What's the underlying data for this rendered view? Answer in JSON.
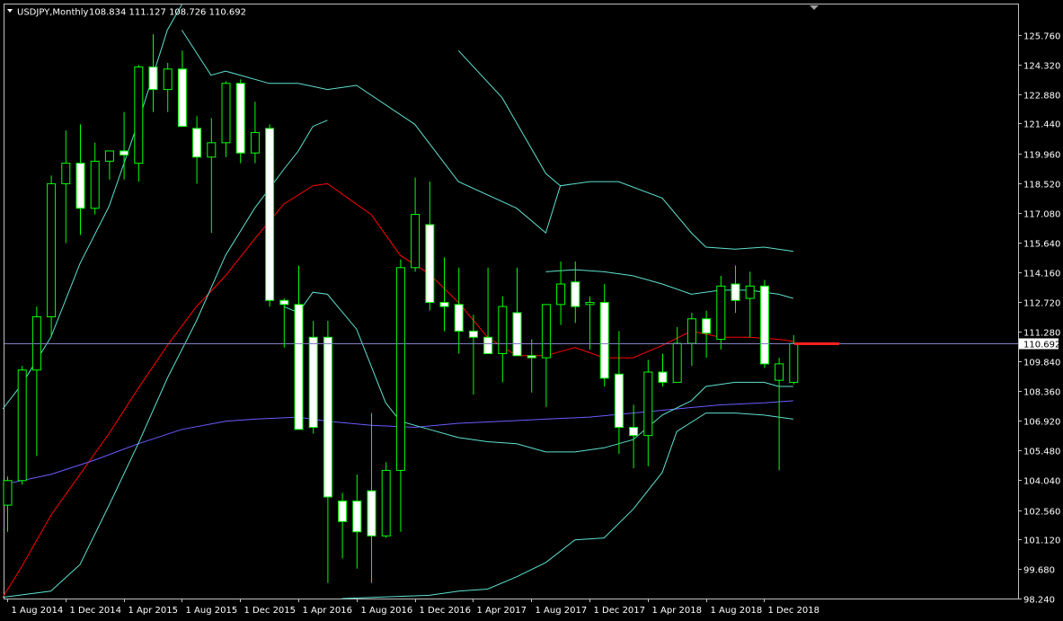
{
  "header": {
    "symbol_timeframe": "USDJPY,Monthly",
    "ohlc": "108.834 111.127 108.726 110.692"
  },
  "colors": {
    "background": "#000000",
    "frame": "#c0c0c0",
    "candle_up": "#000000",
    "candle_down": "#ffffff",
    "wick": "#00ff00",
    "ma_fast": "#ff0000",
    "ma_slow": "#6b5cff",
    "bands": "#5ee0d0",
    "price_line": "#8080c0",
    "price_marker": "#ff2020"
  },
  "chart_data": {
    "type": "candlestick",
    "y_ticks": [
      "125.760",
      "124.320",
      "122.880",
      "121.440",
      "119.960",
      "118.520",
      "117.080",
      "115.640",
      "114.160",
      "112.720",
      "111.280",
      "109.840",
      "108.360",
      "106.920",
      "105.480",
      "104.040",
      "102.560",
      "101.120",
      "99.680",
      "98.240"
    ],
    "x_ticks": [
      "1 Aug 2014",
      "1 Dec 2014",
      "1 Apr 2015",
      "1 Aug 2015",
      "1 Dec 2015",
      "1 Apr 2016",
      "1 Aug 2016",
      "1 Dec 2016",
      "1 Apr 2017",
      "1 Aug 2017",
      "1 Dec 2017",
      "1 Apr 2018",
      "1 Aug 2018",
      "1 Dec 2018"
    ],
    "ylim": [
      98.24,
      125.76
    ],
    "current_price": "110.692",
    "candles": [
      {
        "o": 102.8,
        "h": 104.2,
        "l": 101.5,
        "c": 104.0
      },
      {
        "o": 104.0,
        "h": 109.6,
        "l": 103.8,
        "c": 109.4
      },
      {
        "o": 109.4,
        "h": 112.5,
        "l": 105.2,
        "c": 112.0
      },
      {
        "o": 112.0,
        "h": 118.9,
        "l": 111.0,
        "c": 118.5
      },
      {
        "o": 118.5,
        "h": 121.1,
        "l": 115.6,
        "c": 119.5
      },
      {
        "o": 119.5,
        "h": 121.4,
        "l": 116.0,
        "c": 117.3
      },
      {
        "o": 117.3,
        "h": 120.5,
        "l": 117.0,
        "c": 119.6
      },
      {
        "o": 119.6,
        "h": 120.0,
        "l": 118.7,
        "c": 120.1
      },
      {
        "o": 120.1,
        "h": 122.0,
        "l": 118.7,
        "c": 119.9
      },
      {
        "o": 119.5,
        "h": 124.3,
        "l": 118.6,
        "c": 124.2
      },
      {
        "o": 124.2,
        "h": 125.8,
        "l": 122.0,
        "c": 123.1
      },
      {
        "o": 123.1,
        "h": 124.4,
        "l": 122.0,
        "c": 124.1
      },
      {
        "o": 124.1,
        "h": 125.0,
        "l": 121.5,
        "c": 121.3
      },
      {
        "o": 121.2,
        "h": 121.8,
        "l": 118.5,
        "c": 119.8
      },
      {
        "o": 119.8,
        "h": 121.7,
        "l": 116.1,
        "c": 120.5
      },
      {
        "o": 120.5,
        "h": 123.5,
        "l": 119.8,
        "c": 123.4
      },
      {
        "o": 123.4,
        "h": 123.6,
        "l": 119.5,
        "c": 120.0
      },
      {
        "o": 120.0,
        "h": 122.5,
        "l": 119.5,
        "c": 121.0
      },
      {
        "o": 121.2,
        "h": 121.4,
        "l": 112.5,
        "c": 112.8
      },
      {
        "o": 112.8,
        "h": 112.9,
        "l": 110.5,
        "c": 112.6
      },
      {
        "o": 112.6,
        "h": 114.5,
        "l": 110.8,
        "c": 106.5
      },
      {
        "o": 111.0,
        "h": 111.8,
        "l": 106.3,
        "c": 106.6
      },
      {
        "o": 111.0,
        "h": 111.8,
        "l": 99.0,
        "c": 103.2
      },
      {
        "o": 103.0,
        "h": 103.4,
        "l": 100.2,
        "c": 102.0
      },
      {
        "o": 103.0,
        "h": 104.3,
        "l": 99.7,
        "c": 101.5
      },
      {
        "o": 103.5,
        "h": 107.3,
        "l": 99.0,
        "c": 101.3
      },
      {
        "o": 101.3,
        "h": 104.9,
        "l": 101.2,
        "c": 104.5
      },
      {
        "o": 104.5,
        "h": 114.8,
        "l": 101.5,
        "c": 114.4
      },
      {
        "o": 114.4,
        "h": 118.8,
        "l": 114.2,
        "c": 117.0
      },
      {
        "o": 116.5,
        "h": 118.6,
        "l": 112.3,
        "c": 112.7
      },
      {
        "o": 112.7,
        "h": 114.9,
        "l": 111.3,
        "c": 112.5
      },
      {
        "o": 112.6,
        "h": 114.4,
        "l": 110.2,
        "c": 111.3
      },
      {
        "o": 111.3,
        "h": 112.1,
        "l": 108.2,
        "c": 111.0
      },
      {
        "o": 111.0,
        "h": 114.4,
        "l": 110.7,
        "c": 110.2
      },
      {
        "o": 110.2,
        "h": 113.0,
        "l": 108.8,
        "c": 112.5
      },
      {
        "o": 112.2,
        "h": 114.4,
        "l": 110.5,
        "c": 110.1
      },
      {
        "o": 110.1,
        "h": 110.9,
        "l": 108.3,
        "c": 110.0
      },
      {
        "o": 110.0,
        "h": 112.6,
        "l": 107.6,
        "c": 112.6
      },
      {
        "o": 112.6,
        "h": 114.7,
        "l": 111.6,
        "c": 113.6
      },
      {
        "o": 113.7,
        "h": 114.7,
        "l": 111.7,
        "c": 112.5
      },
      {
        "o": 112.6,
        "h": 113.0,
        "l": 110.4,
        "c": 112.7
      },
      {
        "o": 112.7,
        "h": 113.6,
        "l": 108.6,
        "c": 109.0
      },
      {
        "o": 109.2,
        "h": 111.3,
        "l": 105.3,
        "c": 106.6
      },
      {
        "o": 106.6,
        "h": 107.7,
        "l": 104.6,
        "c": 106.2
      },
      {
        "o": 106.2,
        "h": 109.9,
        "l": 104.7,
        "c": 109.3
      },
      {
        "o": 109.3,
        "h": 110.2,
        "l": 108.6,
        "c": 108.8
      },
      {
        "o": 108.8,
        "h": 111.5,
        "l": 108.8,
        "c": 110.7
      },
      {
        "o": 110.7,
        "h": 112.2,
        "l": 109.6,
        "c": 111.9
      },
      {
        "o": 111.9,
        "h": 112.3,
        "l": 110.0,
        "c": 111.2
      },
      {
        "o": 110.9,
        "h": 114.0,
        "l": 110.4,
        "c": 113.5
      },
      {
        "o": 113.6,
        "h": 114.5,
        "l": 112.2,
        "c": 112.8
      },
      {
        "o": 112.9,
        "h": 114.2,
        "l": 111.0,
        "c": 113.5
      },
      {
        "o": 113.5,
        "h": 113.8,
        "l": 109.5,
        "c": 109.7
      },
      {
        "o": 108.9,
        "h": 110.0,
        "l": 104.5,
        "c": 109.7
      },
      {
        "o": 108.8,
        "h": 111.1,
        "l": 108.7,
        "c": 110.7
      }
    ],
    "series": [
      {
        "points": [
          [
            -0.3,
            98.3
          ],
          [
            1,
            99.8
          ],
          [
            3,
            102.3
          ],
          [
            5,
            104.3
          ],
          [
            7,
            106.3
          ],
          [
            9,
            108.5
          ],
          [
            11,
            110.6
          ],
          [
            13,
            112.5
          ],
          [
            15,
            114.0
          ],
          [
            17,
            115.8
          ],
          [
            19,
            117.5
          ],
          [
            21,
            118.4
          ],
          [
            22,
            118.5
          ],
          [
            25,
            117.0
          ],
          [
            27,
            115.0
          ],
          [
            29,
            114.1
          ],
          [
            31,
            112.7
          ],
          [
            33,
            111.0
          ],
          [
            35,
            110.1
          ],
          [
            37,
            110.1
          ],
          [
            39,
            110.5
          ],
          [
            41,
            110.0
          ],
          [
            43,
            110.0
          ],
          [
            45,
            110.6
          ],
          [
            47,
            111.3
          ],
          [
            49,
            111.0
          ],
          [
            51,
            111.0
          ],
          [
            53,
            110.9
          ],
          [
            54,
            110.8
          ]
        ]
      },
      {
        "points": [
          [
            -0.3,
            103.8
          ],
          [
            3,
            104.3
          ],
          [
            6,
            105.0
          ],
          [
            9,
            105.8
          ],
          [
            12,
            106.5
          ],
          [
            15,
            106.9
          ],
          [
            17,
            107.0
          ],
          [
            20,
            107.1
          ],
          [
            22,
            106.9
          ],
          [
            25,
            106.7
          ],
          [
            28,
            106.6
          ],
          [
            31,
            106.8
          ],
          [
            34,
            106.9
          ],
          [
            37,
            107.0
          ],
          [
            40,
            107.1
          ],
          [
            43,
            107.3
          ],
          [
            46,
            107.5
          ],
          [
            49,
            107.7
          ],
          [
            52,
            107.8
          ],
          [
            54,
            107.9
          ]
        ]
      },
      {
        "points": [
          [
            -0.3,
            107.5
          ],
          [
            1,
            108.7
          ],
          [
            3,
            111.0
          ],
          [
            5,
            114.6
          ],
          [
            7,
            117.4
          ],
          [
            9,
            121.5
          ],
          [
            11,
            126.0
          ],
          [
            12,
            128.0
          ]
        ],
        "off_top": true
      },
      {
        "points": [
          [
            -0.3,
            98.3
          ],
          [
            3,
            98.6
          ],
          [
            5,
            99.9
          ],
          [
            7,
            102.8
          ],
          [
            9,
            105.8
          ],
          [
            11,
            109.0
          ],
          [
            13,
            111.8
          ],
          [
            15,
            115.0
          ],
          [
            17,
            117.3
          ],
          [
            19,
            119.2
          ],
          [
            20,
            120.1
          ],
          [
            21,
            121.3
          ],
          [
            22,
            121.6
          ]
        ]
      },
      {
        "points": [
          [
            19,
            112.5
          ],
          [
            20,
            112.2
          ],
          [
            21,
            113.2
          ],
          [
            22,
            113.1
          ],
          [
            24,
            111.4
          ],
          [
            26,
            107.8
          ],
          [
            27,
            106.9
          ],
          [
            29,
            106.5
          ],
          [
            31,
            106.1
          ],
          [
            33,
            105.9
          ],
          [
            35,
            105.8
          ],
          [
            37,
            105.4
          ],
          [
            39,
            105.4
          ],
          [
            41,
            105.6
          ],
          [
            43,
            106.0
          ],
          [
            45,
            107.2
          ],
          [
            47,
            107.9
          ],
          [
            48,
            108.6
          ],
          [
            50,
            108.8
          ],
          [
            52,
            108.8
          ],
          [
            53,
            108.6
          ],
          [
            54,
            108.6
          ]
        ]
      },
      {
        "points": [
          [
            23,
            98.2
          ],
          [
            29,
            98.4
          ],
          [
            31,
            98.6
          ],
          [
            33,
            98.7
          ],
          [
            35,
            99.3
          ],
          [
            37,
            100.0
          ],
          [
            39,
            101.1
          ],
          [
            41,
            101.2
          ],
          [
            43,
            102.6
          ],
          [
            45,
            104.4
          ],
          [
            46,
            106.4
          ],
          [
            48,
            107.3
          ],
          [
            50,
            107.3
          ],
          [
            52,
            107.2
          ],
          [
            54,
            107.0
          ]
        ]
      },
      {
        "points": [
          [
            12,
            126.0
          ],
          [
            14,
            123.8
          ],
          [
            15,
            124.0
          ],
          [
            18,
            123.4
          ],
          [
            20,
            123.4
          ],
          [
            22,
            123.1
          ],
          [
            24,
            123.3
          ],
          [
            28,
            121.4
          ],
          [
            31,
            118.6
          ],
          [
            35,
            117.3
          ],
          [
            37,
            116.1
          ],
          [
            38,
            118.4
          ],
          [
            40,
            118.6
          ],
          [
            42,
            118.6
          ],
          [
            45,
            117.8
          ],
          [
            47,
            116.1
          ],
          [
            48,
            115.4
          ],
          [
            50,
            115.3
          ],
          [
            52,
            115.4
          ],
          [
            54,
            115.2
          ]
        ]
      },
      {
        "points": [
          [
            31,
            125.0
          ],
          [
            34,
            122.7
          ],
          [
            37,
            119.0
          ],
          [
            38,
            118.4
          ]
        ],
        "off_top": true
      },
      {
        "points": [
          [
            37,
            114.2
          ],
          [
            39,
            114.3
          ],
          [
            41,
            114.2
          ],
          [
            43,
            114.0
          ],
          [
            45,
            113.6
          ],
          [
            47,
            113.1
          ],
          [
            49,
            113.3
          ],
          [
            51,
            113.3
          ],
          [
            53,
            113.1
          ],
          [
            54,
            112.9
          ]
        ]
      }
    ]
  }
}
